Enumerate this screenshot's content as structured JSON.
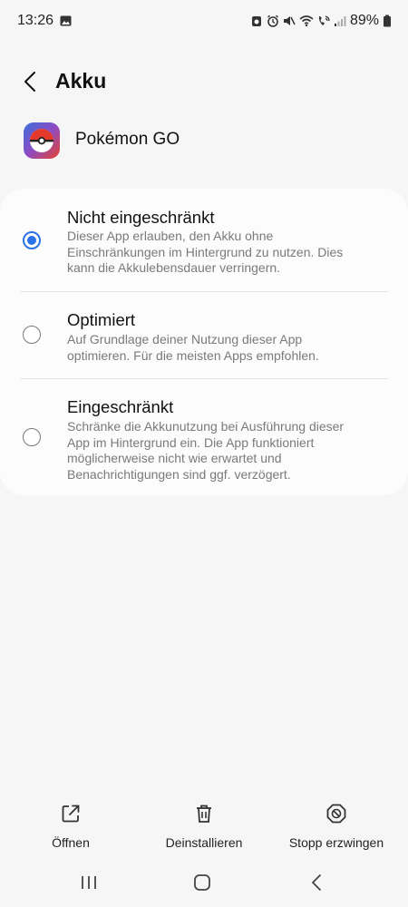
{
  "status_bar": {
    "time": "13:26",
    "battery": "89%",
    "icons": [
      "image-icon",
      "alarm-clock-icon",
      "alarm-icon",
      "mute-icon",
      "wifi-icon",
      "wifi-calling-icon",
      "signal-icon",
      "battery-icon"
    ]
  },
  "header": {
    "title": "Akku"
  },
  "app": {
    "name": "Pokémon GO"
  },
  "options": [
    {
      "title": "Nicht eingeschränkt",
      "desc_lines": [
        "Dieser App erlauben, den Akku ohne",
        "Einschränkungen im Hintergrund zu nutzen. Dies",
        "kann die Akkulebensdauer verringern."
      ],
      "selected": true
    },
    {
      "title": "Optimiert",
      "desc_lines": [
        "Auf Grundlage deiner Nutzung dieser App",
        "optimieren. Für die meisten Apps empfohlen."
      ],
      "selected": false
    },
    {
      "title": "Eingeschränkt",
      "desc_lines": [
        "Schränke die Akkunutzung bei Ausführung dieser",
        "App im Hintergrund ein. Die App funktioniert",
        "möglicherweise nicht wie erwartet und",
        "Benachrichtigungen sind ggf. verzögert."
      ],
      "selected": false
    }
  ],
  "actions": {
    "open": "Öffnen",
    "uninstall": "Deinstallieren",
    "force_stop": "Stopp erzwingen"
  },
  "colors": {
    "accent": "#2a73e8",
    "background": "#f6f6f6",
    "card": "#fcfcfc"
  }
}
